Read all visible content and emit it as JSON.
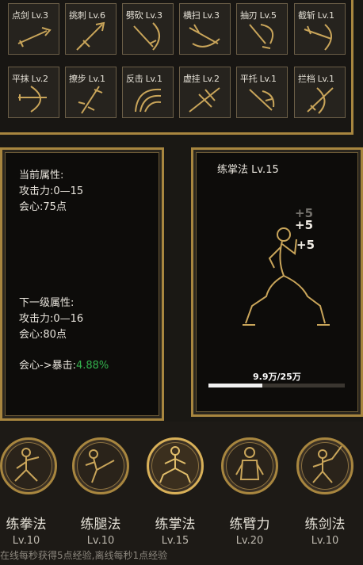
{
  "skills": [
    {
      "label": "点剑 Lv.3",
      "icon": "sword-thrust-icon"
    },
    {
      "label": "挑刺 Lv.6",
      "icon": "sword-pierce-icon"
    },
    {
      "label": "劈砍 Lv.3",
      "icon": "sword-chop-icon"
    },
    {
      "label": "横扫 Lv.3",
      "icon": "sword-sweep-icon"
    },
    {
      "label": "抽刃 Lv.5",
      "icon": "blade-draw-icon"
    },
    {
      "label": "截斩 Lv.1",
      "icon": "sword-slash-icon"
    },
    {
      "label": "平抹 Lv.2",
      "icon": "sword-swipe-icon"
    },
    {
      "label": "撩步 Lv.1",
      "icon": "sword-step-icon"
    },
    {
      "label": "反击 Lv.1",
      "icon": "counter-icon"
    },
    {
      "label": "虚挂 Lv.2",
      "icon": "feint-icon"
    },
    {
      "label": "平托 Lv.1",
      "icon": "sword-lift-icon"
    },
    {
      "label": "拦档 Lv.1",
      "icon": "sword-block-icon"
    }
  ],
  "attributes": {
    "current_title": "当前属性:",
    "current_attack": "攻击力:0—15",
    "current_crit": "会心:75点",
    "next_title": "下一级属性:",
    "next_attack": "攻击力:0—16",
    "next_crit": "会心:80点",
    "crit_to_critrate_label": "会心->暴击:",
    "crit_to_critrate_value": "4.88%"
  },
  "training": {
    "title": "练掌法 Lv.15",
    "gains": [
      "+5",
      "+5",
      "+5"
    ],
    "progress_text": "9.9万/25万",
    "progress_fraction": 0.396
  },
  "tabs": [
    {
      "name": "练拳法",
      "level": "Lv.10",
      "icon": "fist-stance-icon",
      "active": false
    },
    {
      "name": "练腿法",
      "level": "Lv.10",
      "icon": "kick-icon",
      "active": false
    },
    {
      "name": "练掌法",
      "level": "Lv.15",
      "icon": "palm-stance-icon",
      "active": true
    },
    {
      "name": "练臂力",
      "level": "Lv.20",
      "icon": "arm-strength-icon",
      "active": false
    },
    {
      "name": "练剑法",
      "level": "Lv.10",
      "icon": "sword-stance-icon",
      "active": false
    }
  ],
  "footer": "在线每秒获得5点经验,离线每秒1点经验",
  "colors": {
    "gold": "#a8863f",
    "green": "#33b24d",
    "progress": "#f2f2f2"
  }
}
